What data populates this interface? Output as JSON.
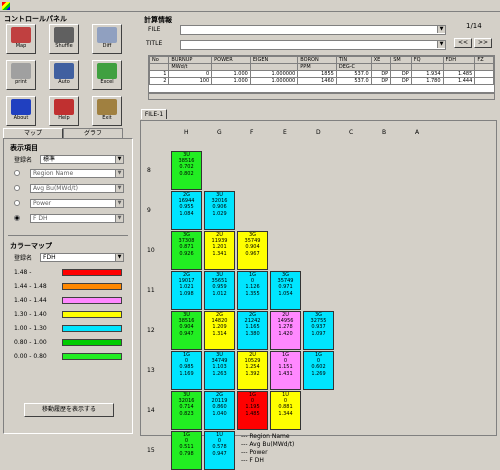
{
  "control_panel": {
    "title": "コントロールパネル",
    "buttons": [
      {
        "label": "Map",
        "icon": "map-icon"
      },
      {
        "label": "Shuffle",
        "icon": "shuffle-icon"
      },
      {
        "label": "Diff",
        "icon": "diff-icon"
      },
      {
        "label": "print",
        "icon": "printer-icon"
      },
      {
        "label": "Auto",
        "icon": "monitor-icon"
      },
      {
        "label": "Excel",
        "icon": "excel-icon"
      },
      {
        "label": "About",
        "icon": "about-icon"
      },
      {
        "label": "Help",
        "icon": "help-icon"
      },
      {
        "label": "Exit",
        "icon": "exit-icon"
      }
    ]
  },
  "tabs": {
    "map": "マップ",
    "graph": "グラフ"
  },
  "display_items": {
    "title": "表示項目",
    "reg_label": "登録名",
    "reg_value": "標準",
    "items": [
      "Region Name",
      "Avg Bu(MWd/t)",
      "Power",
      "F DH"
    ],
    "selected_index": 3
  },
  "color_map": {
    "title": "カラーマップ",
    "reg_label": "登録名",
    "reg_value": "FDH",
    "ranges": [
      {
        "label": "1.48 -",
        "color": "#ff0000"
      },
      {
        "label": "1.44 - 1.48",
        "color": "#ff8800"
      },
      {
        "label": "1.40 - 1.44",
        "color": "#ff88ff"
      },
      {
        "label": "1.30 - 1.40",
        "color": "#ffff00"
      },
      {
        "label": "1.00 - 1.30",
        "color": "#00e5ff"
      },
      {
        "label": "0.80 - 1.00",
        "color": "#00cc00"
      },
      {
        "label": "0.00 - 0.80",
        "color": "#22ee22"
      }
    ],
    "history_button": "移動履歴を表示する"
  },
  "calc_info": {
    "title": "計算情報",
    "file_label": "FILE",
    "title_label": "TITLE",
    "page": "1/14",
    "prev": "<<",
    "next": ">>",
    "headers": [
      "No",
      "BURNUP",
      "POWER",
      "EIGEN",
      "BORON",
      "TIN",
      "XE",
      "SM",
      "FQ",
      "FDH",
      "FZ"
    ],
    "subheaders": [
      "",
      "MWd/t",
      "",
      "",
      "PPM",
      "DEG-C",
      "",
      "",
      "",
      "",
      ""
    ],
    "rows": [
      [
        "1",
        "0",
        "1.000",
        "1.000000",
        "1855",
        "537.0",
        "DP",
        "DP",
        "1.934",
        "1.485",
        ""
      ],
      [
        "2",
        "100",
        "1.000",
        "1.000000",
        "1460",
        "537.0",
        "DP",
        "DP",
        "1.780",
        "1.444",
        ""
      ]
    ]
  },
  "map_tab": "FILE-1",
  "col_labels": [
    "H",
    "G",
    "F",
    "E",
    "D",
    "C",
    "B",
    "A"
  ],
  "row_labels": [
    "8",
    "9",
    "10",
    "11",
    "12",
    "13",
    "14",
    "15"
  ],
  "legend": [
    "--- Region Name",
    "--- Avg Bu(MWd/t)",
    "--- Power",
    "--- F DH"
  ],
  "cells": [
    {
      "r": 0,
      "c": 0,
      "v": [
        "3U",
        "38516",
        "0.702",
        "0.802"
      ],
      "color": "#22ee22"
    },
    {
      "r": 1,
      "c": 0,
      "v": [
        "2G",
        "16944",
        "0.955",
        "1.084"
      ],
      "color": "#00e5ff"
    },
    {
      "r": 1,
      "c": 1,
      "v": [
        "3U",
        "32016",
        "0.906",
        "1.029"
      ],
      "color": "#00e5ff"
    },
    {
      "r": 2,
      "c": 0,
      "v": [
        "3G",
        "37308",
        "0.871",
        "0.926"
      ],
      "color": "#22ee22"
    },
    {
      "r": 2,
      "c": 1,
      "v": [
        "2U",
        "11939",
        "1.201",
        "1.341"
      ],
      "color": "#ffff00"
    },
    {
      "r": 2,
      "c": 2,
      "v": [
        "3G",
        "35749",
        "0.904",
        "0.967"
      ],
      "color": "#ffff00"
    },
    {
      "r": 3,
      "c": 0,
      "v": [
        "2G",
        "19017",
        "1.021",
        "1.098"
      ],
      "color": "#00e5ff"
    },
    {
      "r": 3,
      "c": 1,
      "v": [
        "3U",
        "35651",
        "0.959",
        "1.012"
      ],
      "color": "#00e5ff"
    },
    {
      "r": 3,
      "c": 2,
      "v": [
        "1G",
        "0",
        "1.126",
        "1.355"
      ],
      "color": "#00e5ff"
    },
    {
      "r": 3,
      "c": 3,
      "v": [
        "3G",
        "35749",
        "0.971",
        "1.054"
      ],
      "color": "#00e5ff"
    },
    {
      "r": 4,
      "c": 0,
      "v": [
        "3U",
        "38516",
        "0.904",
        "0.947"
      ],
      "color": "#22ee22"
    },
    {
      "r": 4,
      "c": 1,
      "v": [
        "2G",
        "14820",
        "1.209",
        "1.314"
      ],
      "color": "#ffff00"
    },
    {
      "r": 4,
      "c": 2,
      "v": [
        "2G",
        "21242",
        "1.165",
        "1.380"
      ],
      "color": "#00e5ff"
    },
    {
      "r": 4,
      "c": 3,
      "v": [
        "2U",
        "14956",
        "1.278",
        "1.420"
      ],
      "color": "#ff88ff"
    },
    {
      "r": 4,
      "c": 4,
      "v": [
        "3G",
        "32755",
        "0.937",
        "1.097"
      ],
      "color": "#00e5ff"
    },
    {
      "r": 5,
      "c": 0,
      "v": [
        "1G",
        "0",
        "0.985",
        "1.169"
      ],
      "color": "#00e5ff"
    },
    {
      "r": 5,
      "c": 1,
      "v": [
        "3U",
        "34749",
        "1.103",
        "1.263"
      ],
      "color": "#00e5ff"
    },
    {
      "r": 5,
      "c": 2,
      "v": [
        "2U",
        "10529",
        "1.254",
        "1.392"
      ],
      "color": "#ffff00"
    },
    {
      "r": 5,
      "c": 3,
      "v": [
        "1G",
        "0",
        "1.151",
        "1.431"
      ],
      "color": "#ff88ff"
    },
    {
      "r": 5,
      "c": 4,
      "v": [
        "1G",
        "0",
        "0.602",
        "1.269"
      ],
      "color": "#00e5ff"
    },
    {
      "r": 6,
      "c": 0,
      "v": [
        "3U",
        "32016",
        "0.714",
        "0.823"
      ],
      "color": "#22ee22"
    },
    {
      "r": 6,
      "c": 1,
      "v": [
        "2G",
        "20119",
        "0.860",
        "1.040"
      ],
      "color": "#00e5ff"
    },
    {
      "r": 6,
      "c": 2,
      "v": [
        "1G",
        "0",
        "1.195",
        "1.485"
      ],
      "color": "#ff0000"
    },
    {
      "r": 6,
      "c": 3,
      "v": [
        "1U",
        "0",
        "0.881",
        "1.344"
      ],
      "color": "#ffff00"
    },
    {
      "r": 7,
      "c": 0,
      "v": [
        "1G",
        "0",
        "0.511",
        "0.798"
      ],
      "color": "#22ee22"
    },
    {
      "r": 7,
      "c": 1,
      "v": [
        "1U",
        "0",
        "0.578",
        "0.947"
      ],
      "color": "#00e5ff"
    }
  ]
}
